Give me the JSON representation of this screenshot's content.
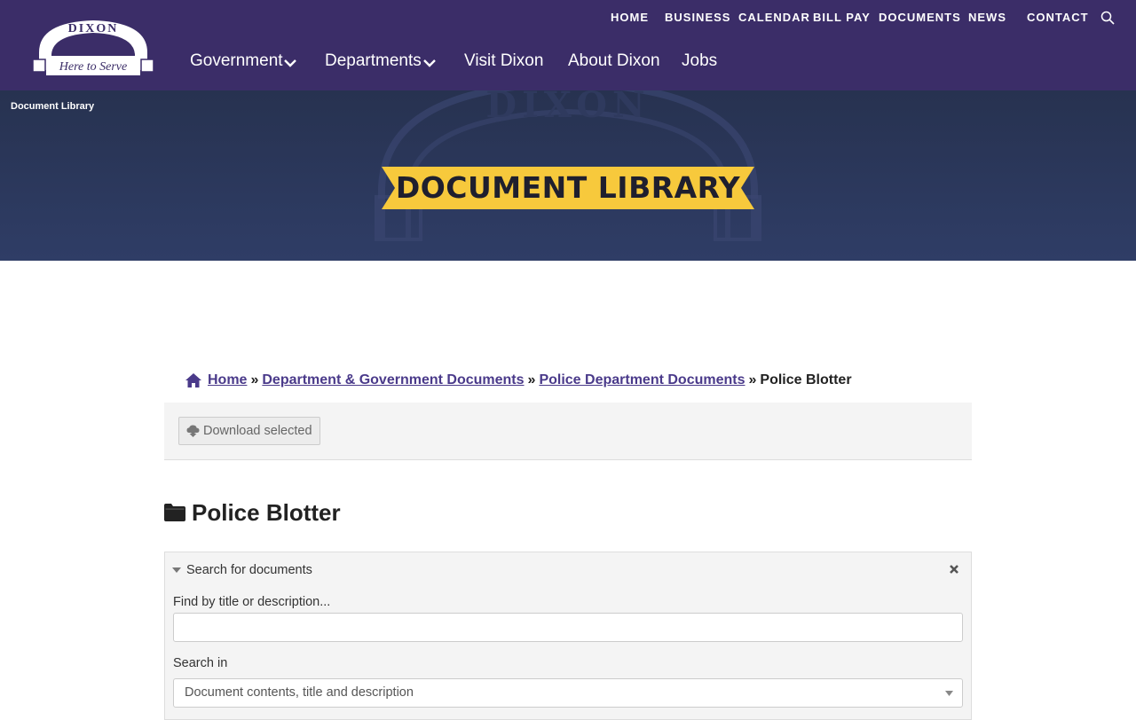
{
  "header": {
    "logo_text_top": "DIXON",
    "logo_text_script": "Here to Serve",
    "utility_nav": [
      {
        "label": "HOME"
      },
      {
        "label": "BUSINESS"
      },
      {
        "label": "CALENDAR"
      },
      {
        "label": "BILL PAY"
      },
      {
        "label": "DOCUMENTS"
      },
      {
        "label": "NEWS"
      },
      {
        "label": "CONTACT"
      }
    ],
    "main_nav": [
      {
        "label": "Government",
        "has_dropdown": true
      },
      {
        "label": "Departments",
        "has_dropdown": true
      },
      {
        "label": "Visit Dixon",
        "has_dropdown": false
      },
      {
        "label": "About Dixon",
        "has_dropdown": false
      },
      {
        "label": "Jobs",
        "has_dropdown": false
      }
    ],
    "search_icon": "search-icon"
  },
  "banner": {
    "page_crumb": "Document Library",
    "title": "DOCUMENT LIBRARY",
    "bg_arch_text": "DIXON"
  },
  "breadcrumb": {
    "home": "Home",
    "sep": "»",
    "links": [
      "Department & Government Documents",
      "Police Department Documents"
    ],
    "current": "Police Blotter"
  },
  "toolbar": {
    "download_label": "Download selected"
  },
  "folder": {
    "title": "Police Blotter"
  },
  "search": {
    "heading": "Search for documents",
    "find_label": "Find by title or description...",
    "find_value": "",
    "search_in_label": "Search in",
    "search_in_value": "Document contents, title and description"
  },
  "colors": {
    "header_bg": "#3b2d68",
    "banner_bg": "#2b385c",
    "ribbon": "#f7c93c",
    "link": "#4a3a8a"
  }
}
